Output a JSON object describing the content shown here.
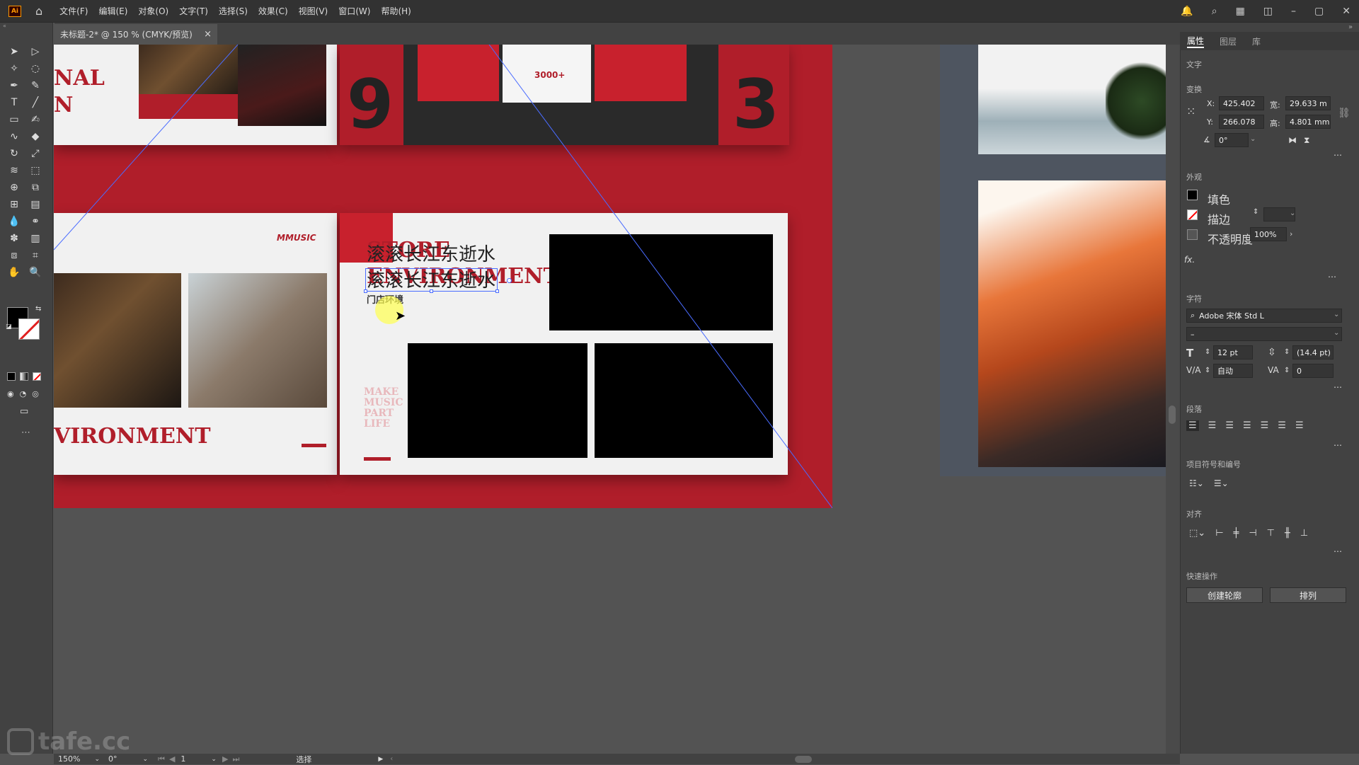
{
  "app": {
    "logo": "Ai"
  },
  "menu": [
    "文件(F)",
    "编辑(E)",
    "对象(O)",
    "文字(T)",
    "选择(S)",
    "效果(C)",
    "视图(V)",
    "窗口(W)",
    "帮助(H)"
  ],
  "tab": {
    "title": "未标题-2* @ 150 % (CMYK/预览)",
    "close": "×"
  },
  "artwork": {
    "nal_text": "NAL",
    "n_text": "N",
    "counter": "3000+",
    "brand_logo": "MMUSIC",
    "store_text": "STORE",
    "environment_text": "ENVIRONMENT",
    "sub_label": "门店环境",
    "chinese_line1": "滚滚长江东逝水",
    "chinese_line2": "滚滚长江东逝水",
    "vertical_text": "MAKE MUSIC PART LIFE",
    "left_environment": "VIRONMENT",
    "big_num_left": "9",
    "big_num_right": "3"
  },
  "panel": {
    "tabs": [
      "属性",
      "图层",
      "库"
    ],
    "type_label": "文字",
    "transform": {
      "title": "变换",
      "x_label": "X:",
      "x": "425.402",
      "y_label": "Y:",
      "y": "266.078",
      "w_label": "宽:",
      "w": "29.633 m",
      "h_label": "高:",
      "h": "4.801 mm",
      "angle": "0°"
    },
    "appearance": {
      "title": "外观",
      "fill": "填色",
      "stroke": "描边",
      "opacity_label": "不透明度",
      "opacity": "100%",
      "fx": "fx."
    },
    "character": {
      "title": "字符",
      "font": "Adobe 宋体 Std L",
      "style": "–",
      "size": "12 pt",
      "leading": "(14.4 pt)",
      "tracking_auto": "自动",
      "kerning": "0"
    },
    "paragraph": {
      "title": "段落"
    },
    "bullets": {
      "title": "项目符号和编号"
    },
    "align": {
      "title": "对齐"
    },
    "quick": {
      "title": "快速操作",
      "create_outline": "创建轮廓",
      "arrange": "排列"
    }
  },
  "status": {
    "zoom": "150%",
    "rotate": "0°",
    "page": "1",
    "mode": "选择"
  },
  "watermark": "tafe.cc",
  "colors": {
    "accent_red": "#b01e2a",
    "ui_dark": "#424242",
    "selection_blue": "#4a6cff"
  }
}
